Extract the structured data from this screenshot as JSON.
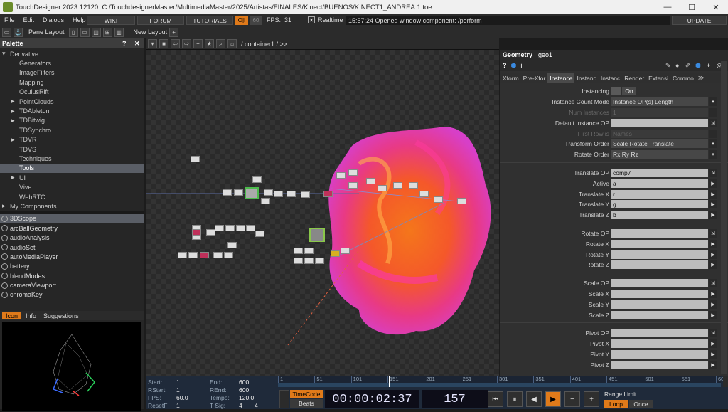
{
  "window": {
    "title": "TouchDesigner 2023.12120: C:/TouchdesignerMaster/MultimediaMaster/2025/Artistas/FINALES/Kinect/BUENOS/KINECT1_ANDREA.1.toe"
  },
  "menubar": {
    "items": [
      "File",
      "Edit",
      "Dialogs",
      "Help"
    ],
    "wiki": "WIKI",
    "forum": "FORUM",
    "tutorials": "TUTORIALS",
    "perf_badge": "O|I",
    "fps_target": "60",
    "fps_label": "FPS:",
    "fps_value": "31",
    "realtime": "Realtime",
    "status": "15:57:24 Opened window component: /perform",
    "update": "UPDATE"
  },
  "toolbar": {
    "pane_layout": "Pane Layout",
    "new_layout": "New Layout"
  },
  "palette": {
    "title": "Palette",
    "tree": [
      {
        "label": "Derivative",
        "indent": 0,
        "arrow": "▾"
      },
      {
        "label": "Generators",
        "indent": 1,
        "arrow": ""
      },
      {
        "label": "ImageFilters",
        "indent": 1,
        "arrow": ""
      },
      {
        "label": "Mapping",
        "indent": 1,
        "arrow": ""
      },
      {
        "label": "OculusRift",
        "indent": 1,
        "arrow": ""
      },
      {
        "label": "PointClouds",
        "indent": 1,
        "arrow": "▸"
      },
      {
        "label": "TDAbleton",
        "indent": 1,
        "arrow": "▸"
      },
      {
        "label": "TDBitwig",
        "indent": 1,
        "arrow": "▸"
      },
      {
        "label": "TDSynchro",
        "indent": 1,
        "arrow": ""
      },
      {
        "label": "TDVR",
        "indent": 1,
        "arrow": "▸"
      },
      {
        "label": "TDVS",
        "indent": 1,
        "arrow": ""
      },
      {
        "label": "Techniques",
        "indent": 1,
        "arrow": ""
      },
      {
        "label": "Tools",
        "indent": 1,
        "arrow": "",
        "selected": true
      },
      {
        "label": "UI",
        "indent": 1,
        "arrow": "▸"
      },
      {
        "label": "Vive",
        "indent": 1,
        "arrow": ""
      },
      {
        "label": "WebRTC",
        "indent": 1,
        "arrow": ""
      },
      {
        "label": "My Components",
        "indent": 0,
        "arrow": "▸"
      }
    ],
    "components": [
      "3DScope",
      "arcBallGeometry",
      "audioAnalysis",
      "audioSet",
      "autoMediaPlayer",
      "battery",
      "blendModes",
      "cameraViewport",
      "chromaKey"
    ],
    "tabs": [
      "Icon",
      "Info",
      "Suggestions"
    ]
  },
  "network": {
    "path": "/ container1 / >>"
  },
  "params": {
    "op_type": "Geometry",
    "op_name": "geo1",
    "tabs": [
      "Xform",
      "Pre-Xfor",
      "Instance",
      "Instanc",
      "Instanc",
      "Render",
      "Extensi",
      "Commo"
    ],
    "rows": [
      {
        "label": "Instancing",
        "value": "On",
        "kind": "toggle"
      },
      {
        "label": "Instance Count Mode",
        "value": "Instance OP(s) Length",
        "kind": "menu"
      },
      {
        "label": "Num Instances",
        "value": "1",
        "kind": "dim"
      },
      {
        "label": "Default Instance OP",
        "value": "",
        "kind": "op"
      },
      {
        "label": "First Row is",
        "value": "Names",
        "kind": "dim"
      },
      {
        "label": "Transform Order",
        "value": "Scale Rotate Translate",
        "kind": "menu"
      },
      {
        "label": "Rotate Order",
        "value": "Rx Ry Rz",
        "kind": "menu"
      },
      {
        "label": "",
        "value": "",
        "kind": "gap"
      },
      {
        "label": "Translate OP",
        "value": "comp7",
        "kind": "op"
      },
      {
        "label": "Active",
        "value": "a",
        "kind": "arrow"
      },
      {
        "label": "Translate X",
        "value": "r",
        "kind": "arrow"
      },
      {
        "label": "Translate Y",
        "value": "g",
        "kind": "arrow"
      },
      {
        "label": "Translate Z",
        "value": "b",
        "kind": "arrow"
      },
      {
        "label": "",
        "value": "",
        "kind": "gap"
      },
      {
        "label": "Rotate OP",
        "value": "",
        "kind": "op"
      },
      {
        "label": "Rotate X",
        "value": "",
        "kind": "arrow"
      },
      {
        "label": "Rotate Y",
        "value": "",
        "kind": "arrow"
      },
      {
        "label": "Rotate Z",
        "value": "",
        "kind": "arrow"
      },
      {
        "label": "",
        "value": "",
        "kind": "gap"
      },
      {
        "label": "Scale OP",
        "value": "",
        "kind": "op"
      },
      {
        "label": "Scale X",
        "value": "",
        "kind": "arrow"
      },
      {
        "label": "Scale Y",
        "value": "",
        "kind": "arrow"
      },
      {
        "label": "Scale Z",
        "value": "",
        "kind": "arrow"
      },
      {
        "label": "",
        "value": "",
        "kind": "gap"
      },
      {
        "label": "Pivot OP",
        "value": "",
        "kind": "op"
      },
      {
        "label": "Pivot X",
        "value": "",
        "kind": "arrow"
      },
      {
        "label": "Pivot Y",
        "value": "",
        "kind": "arrow"
      },
      {
        "label": "Pivot Z",
        "value": "",
        "kind": "arrow"
      }
    ]
  },
  "timeline": {
    "start_l": "Start:",
    "start": "1",
    "end_l": "End:",
    "end": "600",
    "rstart_l": "RStart:",
    "rstart": "1",
    "rend_l": "REnd:",
    "rend": "600",
    "fps_l": "FPS:",
    "fps": "60.0",
    "tempo_l": "Tempo:",
    "tempo": "120.0",
    "resetf_l": "ResetF:",
    "resetf": "1",
    "tsig_l": "T Sig:",
    "tsig_a": "4",
    "tsig_b": "4",
    "ruler": [
      "1",
      "51",
      "101",
      "151",
      "201",
      "251",
      "301",
      "351",
      "401",
      "451",
      "501",
      "551",
      "600"
    ],
    "timecode_btn": "TimeCode",
    "beats_btn": "Beats",
    "timecode": "00:00:02:37",
    "frame": "157",
    "range_limit": "Range Limit",
    "loop": "Loop",
    "once": "Once"
  }
}
